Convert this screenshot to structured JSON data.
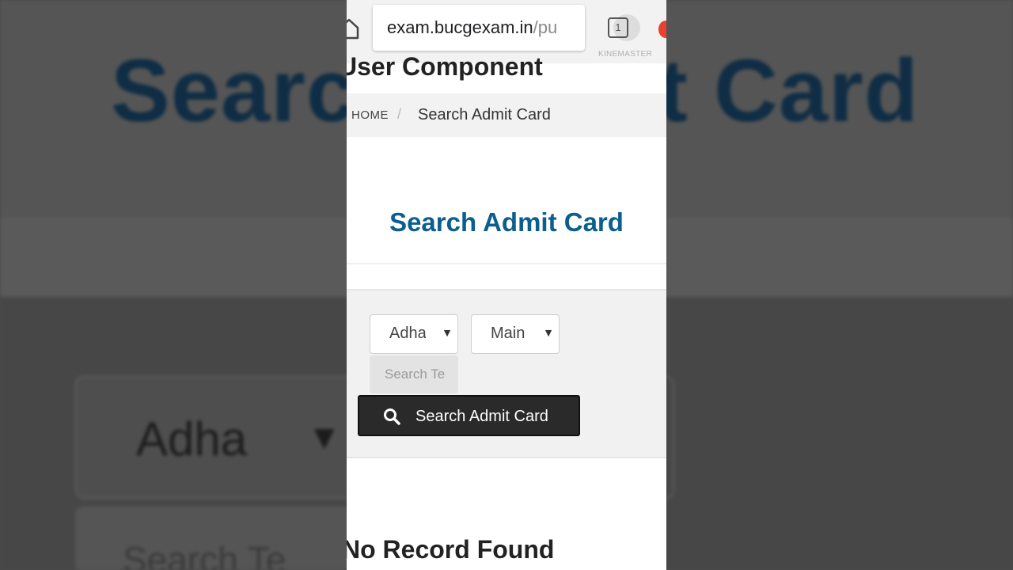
{
  "background": {
    "title": "Search Admit Card",
    "select_text": "Adha",
    "select_arrow": "▼",
    "search_text": "Search Te"
  },
  "browser": {
    "url_host": "exam.bucgexam.in",
    "url_path": "/pu",
    "tabs_count": "1",
    "watermark": "KINEMASTER",
    "home_icon": "home-icon",
    "tabs_icon": "tabs-icon"
  },
  "page": {
    "heading": "User Component",
    "breadcrumb": {
      "home": "HOME",
      "separator": "/",
      "current": "Search Admit Card"
    },
    "section_title": "Search Admit Card",
    "form": {
      "select_1": {
        "value": "Adhaar",
        "arrow": "▼"
      },
      "select_2": {
        "value": "Main",
        "arrow": "▼"
      },
      "search_placeholder": "Search Term",
      "search_button": "Search Admit Card"
    },
    "result_text": "No Record Found"
  },
  "colors": {
    "title_blue": "#0b5e8d",
    "button_dark": "#2a2a2a",
    "notification_red": "#e8412f"
  }
}
